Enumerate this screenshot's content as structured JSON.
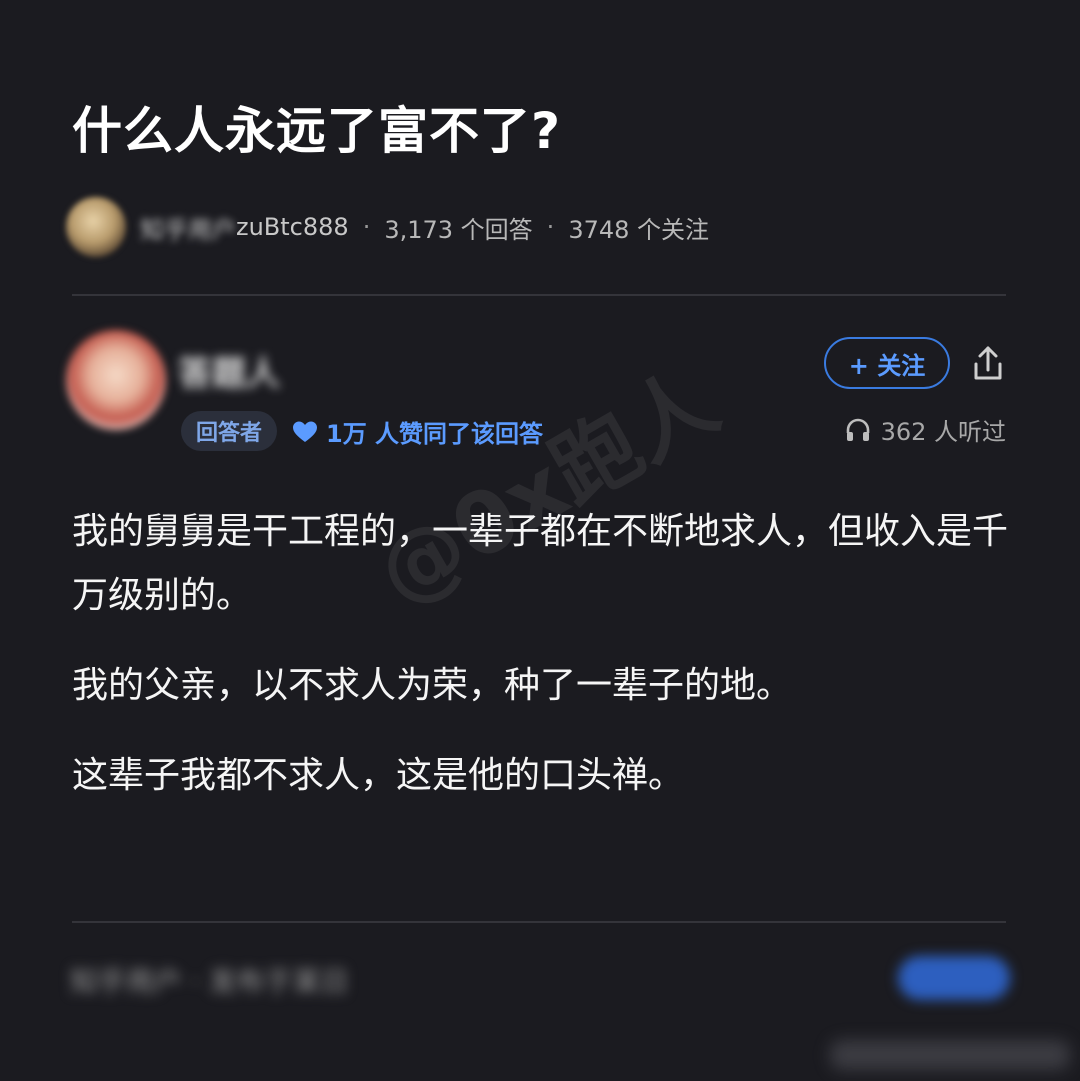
{
  "question": {
    "title": "什么人永远了富不了?"
  },
  "meta": {
    "asker_name": "知乎用户",
    "asker_id": "zuBtc888",
    "separator": "·",
    "answers_count": "3,173 个回答",
    "followers_count": "3748 个关注"
  },
  "answer": {
    "author_name": "答题人",
    "role_badge": "回答者",
    "likes": "1万 人赞同了该回答",
    "follow_label": "+ 关注",
    "listens": "362 人听过",
    "paragraphs": [
      "我的舅舅是干工程的，一辈子都在不断地求人，但收入是千万级别的。",
      "我的父亲，以不求人为荣，种了一辈子的地。",
      "这辈子我都不求人，这是他的口头禅。"
    ],
    "watermark": "@0x跑人"
  },
  "footer": {
    "blurred_text": "知乎用户 · 发布于某日"
  },
  "colors": {
    "background": "#1b1b20",
    "accent": "#5b9bff",
    "badge_bg": "#2b2f3b",
    "divider": "#34343a"
  },
  "icons": {
    "likes": "heart-icon",
    "share": "share-icon",
    "listens": "headphones-icon"
  }
}
